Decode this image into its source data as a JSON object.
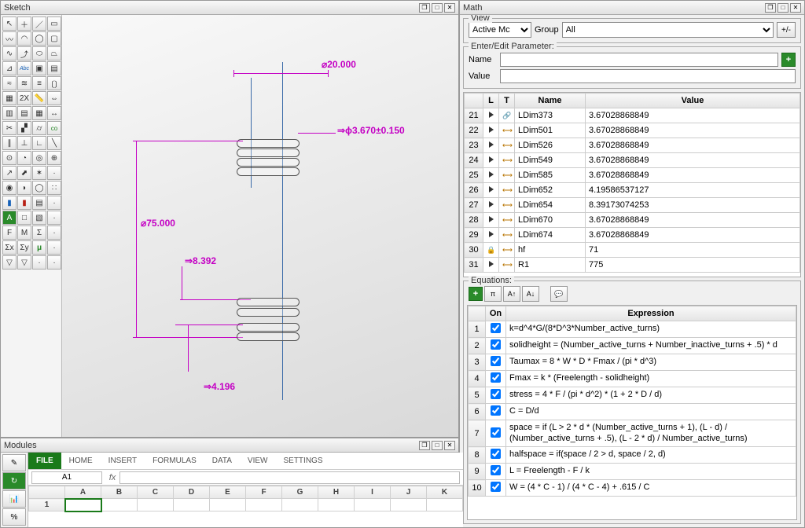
{
  "sketch": {
    "title": "Sketch",
    "tools": [
      "select-icon",
      "crosshair-icon",
      "line-tool-icon",
      "rectangle-tool-icon",
      "polyline-icon",
      "arc-icon",
      "circle-3pt-icon",
      "rect-outline-icon",
      "spline-icon",
      "curve-tool-icon",
      "ellipse-tool-icon",
      "trapezoid-icon",
      "axis-icon",
      "text-abc-icon",
      "frame-icon",
      "image-placeholder-icon",
      "wave-icon",
      "profiles-icon",
      "pattern-icon",
      "brackets-icon",
      "grid-icon",
      "ruler-2x-icon",
      "tape-icon",
      "extend-icon",
      "grid-vert-icon",
      "grid-horiz-icon",
      "table-icon",
      "dim-arrows-icon",
      "scissors-icon",
      "road-icon",
      "cylinder-icon",
      "co-icon",
      "parallel-icon",
      "perpendicular-icon",
      "angle-right-icon",
      "diag-icon",
      "circle-center-icon",
      "circle-radius-icon",
      "concentric-icon",
      "target-icon",
      "arrow-up-icon",
      "arrow-corner-icon",
      "star6-icon",
      "blank-icon",
      "circle-dot-icon",
      "semicircle-icon",
      "donut-icon",
      "dots-grid-icon",
      "blue-panel-icon",
      "red-panel-icon",
      "layers-icon",
      "blank2-icon",
      "a-green-icon",
      "square-edit-icon",
      "picture-icon",
      "blank3-icon",
      "f-icon",
      "m-icon",
      "sigma-icon",
      "blank4-icon",
      "sigma-x-icon",
      "sigma-y-icon",
      "mu-icon",
      "blank5-icon",
      "down-tri-icon",
      "down-tri2-icon",
      "blank6-icon",
      "blank7-icon"
    ],
    "dimensions": {
      "d_top": "⌀20.000",
      "d_diam": "⇒ϕ3.670±0.150",
      "d_height": "⌀75.000",
      "d_spacing": "⇒8.392",
      "d_half": "⇒4.196"
    }
  },
  "math": {
    "title": "Math",
    "view": {
      "legend": "View",
      "activeLabel": "Active Mc",
      "groupLabel": "Group",
      "groupValue": "All",
      "toggle": "+/-"
    },
    "edit": {
      "legend": "Enter/Edit Parameter:",
      "nameLabel": "Name",
      "valueLabel": "Value",
      "name": "",
      "value": ""
    },
    "paramHeaders": {
      "l": "L",
      "t": "T",
      "name": "Name",
      "value": "Value"
    },
    "params": [
      {
        "n": 21,
        "l": "arrow",
        "t": "link",
        "name": "LDim373",
        "value": "3.67028868849"
      },
      {
        "n": 22,
        "l": "arrow",
        "t": "dim",
        "name": "LDim501",
        "value": "3.67028868849"
      },
      {
        "n": 23,
        "l": "arrow",
        "t": "dim",
        "name": "LDim526",
        "value": "3.67028868849"
      },
      {
        "n": 24,
        "l": "arrow",
        "t": "dim",
        "name": "LDim549",
        "value": "3.67028868849"
      },
      {
        "n": 25,
        "l": "arrow",
        "t": "dim",
        "name": "LDim585",
        "value": "3.67028868849"
      },
      {
        "n": 26,
        "l": "arrow",
        "t": "dim",
        "name": "LDim652",
        "value": "4.19586537127"
      },
      {
        "n": 27,
        "l": "arrow",
        "t": "dim",
        "name": "LDim654",
        "value": "8.39173074253"
      },
      {
        "n": 28,
        "l": "arrow",
        "t": "dim",
        "name": "LDim670",
        "value": "3.67028868849"
      },
      {
        "n": 29,
        "l": "arrow",
        "t": "dim",
        "name": "LDim674",
        "value": "3.67028868849"
      },
      {
        "n": 30,
        "l": "lock",
        "t": "dim",
        "name": "hf",
        "value": "71"
      },
      {
        "n": 31,
        "l": "arrow",
        "t": "dim",
        "name": "R1",
        "value": "775"
      }
    ],
    "equations": {
      "legend": "Equations:",
      "headers": {
        "on": "On",
        "expr": "Expression"
      },
      "rows": [
        {
          "n": 1,
          "on": true,
          "expr": "k=d^4*G/(8*D^3*Number_active_turns)"
        },
        {
          "n": 2,
          "on": true,
          "expr": "solidheight = (Number_active_turns + Number_inactive_turns + .5) * d"
        },
        {
          "n": 3,
          "on": true,
          "expr": "Taumax = 8 * W * D * Fmax / (pi * d^3)"
        },
        {
          "n": 4,
          "on": true,
          "expr": "Fmax = k * (Freelength - solidheight)"
        },
        {
          "n": 5,
          "on": true,
          "expr": "stress = 4 * F / (pi * d^2) * (1 + 2 * D / d)"
        },
        {
          "n": 6,
          "on": true,
          "expr": "C = D/d"
        },
        {
          "n": 7,
          "on": true,
          "expr": "space = if (L > 2 * d * (Number_active_turns + 1), (L - d) / (Number_active_turns + .5), (L - 2 * d) / Number_active_turns)"
        },
        {
          "n": 8,
          "on": true,
          "expr": "halfspace = if(space / 2 > d, space / 2, d)"
        },
        {
          "n": 9,
          "on": true,
          "expr": "L = Freelength - F / k"
        },
        {
          "n": 10,
          "on": true,
          "expr": "W = (4 * C - 1) / (4 * C - 4) + .615 / C"
        }
      ]
    }
  },
  "modules": {
    "title": "Modules",
    "ribbon": {
      "file": "FILE",
      "tabs": [
        "HOME",
        "INSERT",
        "FORMULAS",
        "DATA",
        "VIEW",
        "SETTINGS"
      ]
    },
    "cellref": "A1",
    "columns": [
      "A",
      "B",
      "C",
      "D",
      "E",
      "F",
      "G",
      "H",
      "I",
      "J",
      "K"
    ],
    "rows": [
      "1"
    ]
  }
}
